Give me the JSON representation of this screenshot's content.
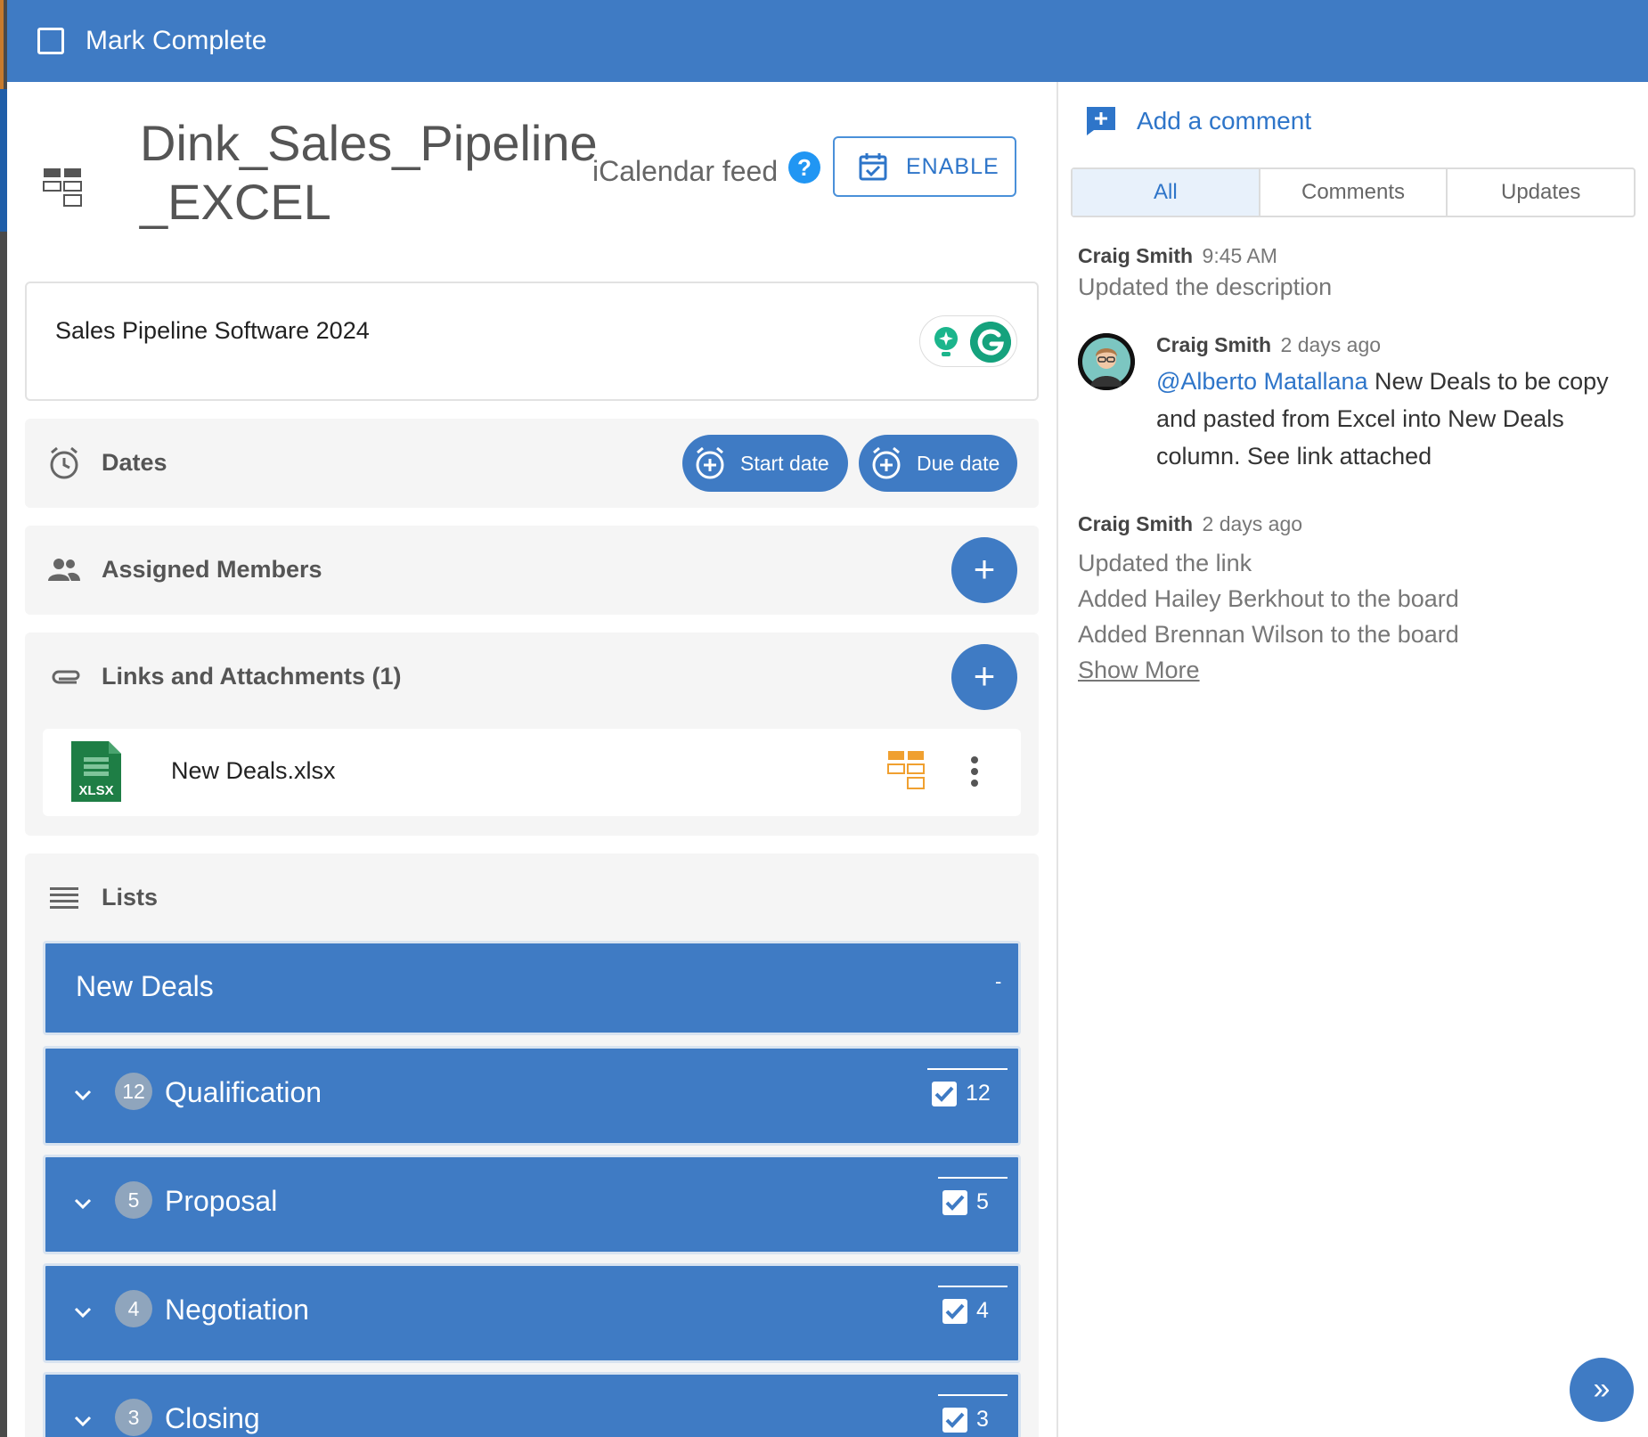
{
  "topbar": {
    "mark_complete": "Mark Complete"
  },
  "card": {
    "title": "Dink_Sales_Pipeline_EXCEL",
    "ical_label": "iCalendar feed",
    "help_label": "?",
    "enable_label": "ENABLE",
    "description": "Sales Pipeline Software 2024"
  },
  "sections": {
    "dates": {
      "label": "Dates",
      "start_date": "Start date",
      "due_date": "Due date"
    },
    "members": {
      "label": "Assigned Members",
      "add": "+"
    },
    "links": {
      "label": "Links and Attachments (1)",
      "add": "+"
    },
    "attachments": [
      {
        "name": "New Deals.xlsx",
        "icon_text": "XLSX"
      }
    ],
    "lists": {
      "label": "Lists"
    }
  },
  "lists": [
    {
      "title": "New Deals",
      "collapse": "-"
    },
    {
      "title": "Qualification",
      "count": "12",
      "checked": "12"
    },
    {
      "title": "Proposal",
      "count": "5",
      "checked": "5"
    },
    {
      "title": "Negotiation",
      "count": "4",
      "checked": "4"
    },
    {
      "title": "Closing",
      "count": "3",
      "checked": "3"
    }
  ],
  "comments": {
    "add_label": "Add a comment",
    "tabs": [
      "All",
      "Comments",
      "Updates"
    ],
    "active_tab": "All",
    "feed": [
      {
        "author": "Craig Smith",
        "time": "9:45 AM",
        "lines": [
          "Updated the description"
        ]
      },
      {
        "author": "Craig Smith",
        "time": "2 days ago",
        "mention": "@Alberto Matallana",
        "text": " New Deals to be copy and pasted from Excel into New Deals column. See link attached"
      },
      {
        "author": "Craig Smith",
        "time": "2 days ago",
        "lines": [
          "Updated the link",
          "Added Hailey Berkhout to the board",
          "Added Brennan Wilson to the board"
        ]
      }
    ],
    "show_more": "Show More"
  },
  "expand_label": "»",
  "colors": {
    "primary": "#3f7bc4",
    "accent": "#2e75c9",
    "excel_green": "#1e7e45",
    "grammarly_green": "#15a27d",
    "orange": "#f0a030"
  }
}
